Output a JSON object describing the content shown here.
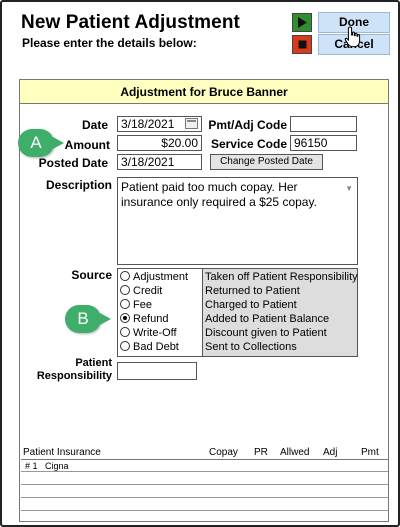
{
  "header": {
    "title": "New Patient Adjustment",
    "subtitle": "Please enter the details below:",
    "done_label": "Done",
    "cancel_label": "Cancel",
    "done_icon": "play-icon",
    "cancel_icon": "stop-icon",
    "colors": {
      "done_square": "#2f8f2f",
      "cancel_square": "#d93a1c",
      "button_bg": "#cfe3f8"
    }
  },
  "panel": {
    "title": "Adjustment for Bruce Banner",
    "header_bg": "#ffffc0"
  },
  "form": {
    "date_label": "Date",
    "date_value": "3/18/2021",
    "amount_label": "Amount",
    "amount_value": "$20.00",
    "posted_date_label": "Posted Date",
    "posted_date_value": "3/18/2021",
    "pmt_adj_code_label": "Pmt/Adj Code",
    "pmt_adj_code_value": "",
    "service_code_label": "Service Code",
    "service_code_value": "96150",
    "change_posted_date_label": "Change Posted Date",
    "description_label": "Description",
    "description_value": "Patient paid too much copay. Her insurance only required a $25 copay.",
    "source_label": "Source",
    "patient_responsibility_label_line1": "Patient",
    "patient_responsibility_label_line2": "Responsibility",
    "patient_responsibility_value": ""
  },
  "source_options": [
    {
      "label": "Adjustment",
      "description": "Taken off Patient Responsibility",
      "selected": false
    },
    {
      "label": "Credit",
      "description": "Returned to Patient",
      "selected": false
    },
    {
      "label": "Fee",
      "description": "Charged to Patient",
      "selected": false
    },
    {
      "label": "Refund",
      "description": "Added to Patient Balance",
      "selected": true
    },
    {
      "label": "Write-Off",
      "description": "Discount given to Patient",
      "selected": false
    },
    {
      "label": "Bad Debt",
      "description": "Sent to Collections",
      "selected": false
    }
  ],
  "callouts": {
    "a": "A",
    "b": "B",
    "color": "#3fae6a"
  },
  "insurance": {
    "title": "Patient Insurance",
    "columns": [
      "Copay",
      "PR",
      "Allwed",
      "Adj",
      "Pmt"
    ],
    "rows": [
      {
        "num": "# 1",
        "name": "Cigna"
      }
    ]
  }
}
